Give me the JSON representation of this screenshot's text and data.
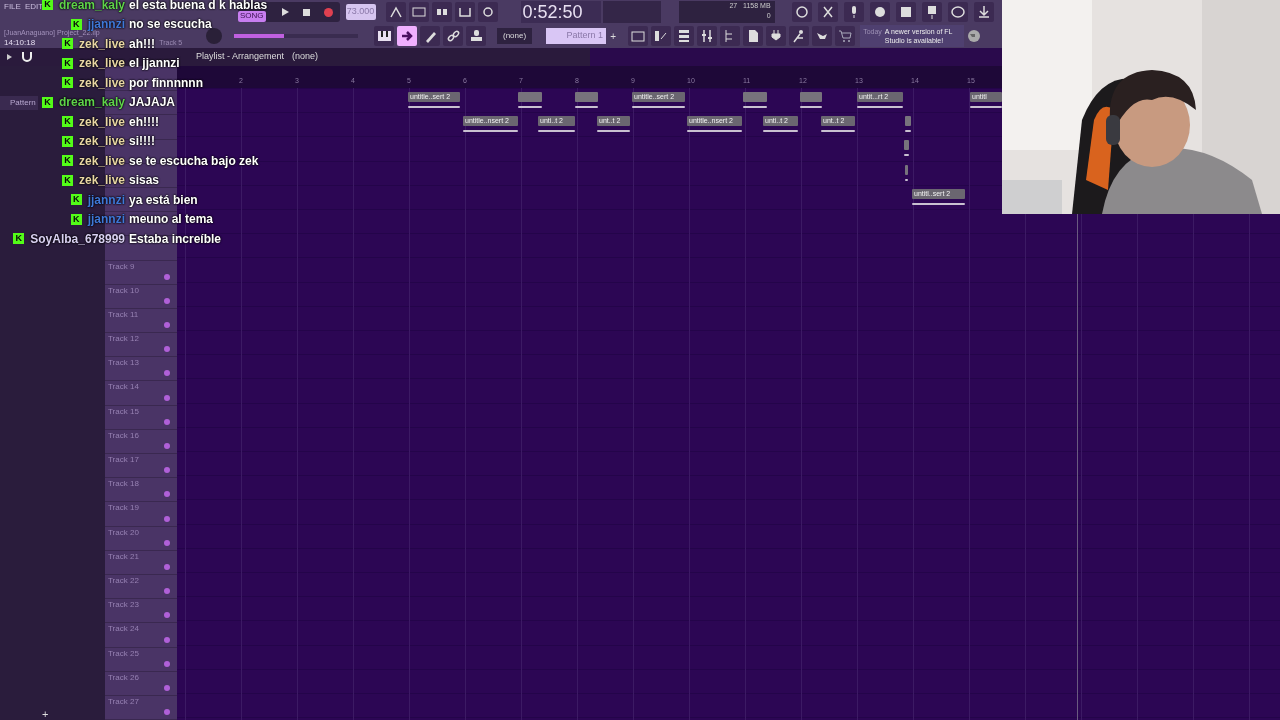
{
  "menu": [
    "FILE",
    "EDIT"
  ],
  "project": {
    "file": "[JuanAnaguano] Project_22.flp",
    "time": "14:10:18",
    "hint": "Track 5"
  },
  "transport": {
    "mode": "SONG",
    "tempo": "73.000",
    "clock": "0:52:50",
    "volume": {
      "level": 0.4
    }
  },
  "monitor": {
    "polyphony": "27",
    "memory": "1158 MB",
    "cpu": "0"
  },
  "tools": [
    {
      "kind": "piano",
      "selected": false
    },
    {
      "kind": "arrow",
      "selected": true
    },
    {
      "kind": "pen",
      "selected": false
    },
    {
      "kind": "link",
      "selected": false
    },
    {
      "kind": "stamp",
      "selected": false
    }
  ],
  "pattern": {
    "channel": "(none)",
    "name": "Pattern 1",
    "add": "+"
  },
  "notice": {
    "when": "Today",
    "text": "A newer version of FL Studio is available!"
  },
  "playlist": {
    "title": "Playlist - Arrangement",
    "pattern": "(none)",
    "ruler": [
      "2",
      "3",
      "4",
      "5",
      "6",
      "7",
      "8",
      "9",
      "10",
      "11",
      "12",
      "13",
      "14",
      "15"
    ],
    "tracks": [
      {
        "name": "Track 9"
      },
      {
        "name": "Track 10"
      },
      {
        "name": "Track 11"
      },
      {
        "name": "Track 12"
      },
      {
        "name": "Track 13"
      },
      {
        "name": "Track 14"
      },
      {
        "name": "Track 15"
      },
      {
        "name": "Track 16"
      },
      {
        "name": "Track 17"
      },
      {
        "name": "Track 18"
      },
      {
        "name": "Track 19"
      },
      {
        "name": "Track 20"
      },
      {
        "name": "Track 21"
      },
      {
        "name": "Track 22"
      },
      {
        "name": "Track 23"
      },
      {
        "name": "Track 24"
      },
      {
        "name": "Track 25"
      },
      {
        "name": "Track 26"
      },
      {
        "name": "Track 27"
      }
    ],
    "clips": [
      {
        "kind": "labeled",
        "label": "untitle..sert 2"
      },
      {
        "kind": "blank"
      },
      {
        "kind": "blank"
      },
      {
        "kind": "labeled",
        "label": "untitle..sert 2"
      },
      {
        "kind": "blank"
      },
      {
        "kind": "blank"
      },
      {
        "kind": "labeled",
        "label": "untit...rt 2"
      },
      {
        "kind": "labeled",
        "label": "untitl"
      },
      {
        "kind": "labeled",
        "label": "untitle..nsert 2"
      },
      {
        "kind": "labeled",
        "label": "unti..t 2"
      },
      {
        "kind": "labeled",
        "label": "unt..t 2"
      },
      {
        "kind": "labeled",
        "label": "untitle..nsert 2"
      },
      {
        "kind": "labeled",
        "label": "unti..t 2"
      },
      {
        "kind": "labeled",
        "label": "unt..t 2"
      },
      {
        "kind": "blank"
      },
      {
        "kind": "blank"
      },
      {
        "kind": "blank"
      },
      {
        "kind": "labeled",
        "label": "untitl..sert 2"
      }
    ]
  },
  "browser": {
    "items": [
      {
        "label": "Pattern"
      }
    ],
    "add": "+"
  },
  "chat": [
    {
      "user": "dream_kaly",
      "color": "#5fd34a",
      "badge": "K",
      "text": "el esta buena d k hablas"
    },
    {
      "user": "jjannzi",
      "color": "#3f78d8",
      "badge": "K",
      "text": "no se escucha"
    },
    {
      "user": "zek_live",
      "color": "#e9d7a4",
      "badge": "K",
      "text": "ah!!!"
    },
    {
      "user": "zek_live",
      "color": "#e9d7a4",
      "badge": "K",
      "text": "el jjannzi"
    },
    {
      "user": "zek_live",
      "color": "#e9d7a4",
      "badge": "K",
      "text": "por finnnnnn"
    },
    {
      "user": "dream_kaly",
      "color": "#5fd34a",
      "badge": "K",
      "text": "JAJAJA"
    },
    {
      "user": "zek_live",
      "color": "#e9d7a4",
      "badge": "K",
      "text": "eh!!!!"
    },
    {
      "user": "zek_live",
      "color": "#e9d7a4",
      "badge": "K",
      "text": "si!!!!"
    },
    {
      "user": "zek_live",
      "color": "#e9d7a4",
      "badge": "K",
      "text": "se te escucha bajo zek"
    },
    {
      "user": "zek_live",
      "color": "#e9d7a4",
      "badge": "K",
      "text": "sisas"
    },
    {
      "user": "jjannzi",
      "color": "#3f78d8",
      "badge": "K",
      "text": "ya está bien"
    },
    {
      "user": "jjannzi",
      "color": "#3f78d8",
      "badge": "K",
      "text": "meuno al tema"
    },
    {
      "user": "SoyAlba_678999",
      "color": "#d9d0f2",
      "badge": "K",
      "text": "Estaba increíble"
    }
  ]
}
